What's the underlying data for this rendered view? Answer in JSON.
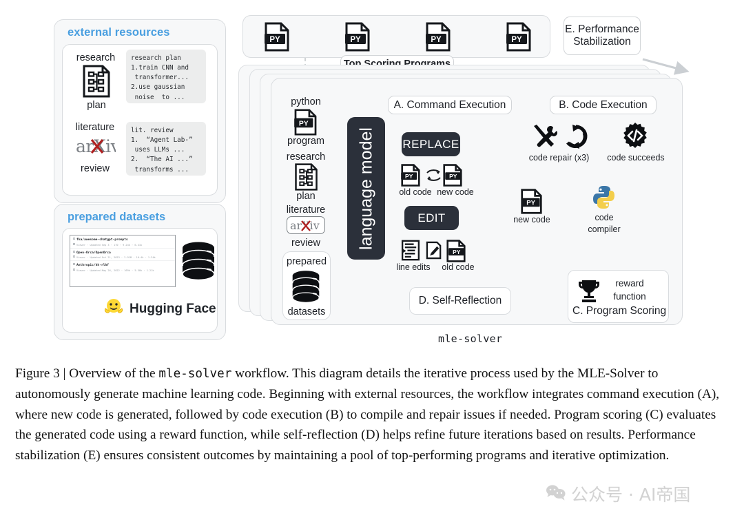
{
  "figure": {
    "label": "Figure 3 |",
    "caption_part1": " Overview of the ",
    "caption_mono": "mle-solver",
    "caption_part2": " workflow. This diagram details the iterative process used by the MLE-Solver to autonomously generate machine learning code. Beginning with external resources, the workflow integrates command execution (A), where new code is generated, followed by code execution (B) to compile and repair issues if needed. Program scoring (C) evaluates the generated code using a reward function, while self-reflection (D) helps refine future iterations based on results. Performance stabilization (E) ensures consistent outcomes by maintaining a pool of top-performing programs and iterative optimization.",
    "solver_name": "mle-solver"
  },
  "colors": {
    "accent_blue": "#4a9fe0",
    "dark": "#2b303a",
    "panel_bg": "#f7f8f9",
    "red_dash": "#e9a3a3",
    "green_dash": "#a8d9ae",
    "gray_dash": "#c8cccf"
  },
  "external_resources": {
    "title": "external resources",
    "items": [
      {
        "label_top": "research",
        "label_bottom": "plan",
        "icon": "document-flowchart-icon",
        "text_lines": "research plan\n1.train CNN and\n transformer...\n2.use gaussian\n noise  to ..."
      },
      {
        "label_top": "literature",
        "label_bottom": "review",
        "icon": "arxiv-logo-icon",
        "arxiv_text": "arXiv",
        "text_lines": "lit. review\n1.  “Agent Lab-”\n uses LLMs ...\n2.  “The AI ...”\n transforms ..."
      }
    ]
  },
  "prepared_datasets": {
    "title": "prepared datasets",
    "brand": "Hugging Face",
    "brand_icon": "hugging-face-emoji-icon",
    "db_icon": "database-stack-icon",
    "rows": [
      {
        "name": "fka/awesome-chatgpt-prompts",
        "meta": "Viewer · Updated Sep 3 · 170 · 9.24k · 6.41k"
      },
      {
        "name": "Open-Orca/OpenOrca",
        "meta": "Viewer · Updated Oct 21, 2023 · 2.91M · 10.4k · 1.34k"
      },
      {
        "name": "Anthropic/hh-rlhf",
        "meta": "Viewer · Updated May 26, 2022 · 169k · 5.50k · 1.21k"
      }
    ]
  },
  "top_bar": {
    "title": "Top Scoring Programs",
    "program_icon": "py-file-icon",
    "program_count": 4,
    "performance_stabilization": "E. Performance\nStabilization"
  },
  "solver": {
    "inputs": [
      {
        "label_top": "python",
        "label_bottom": "program",
        "icon": "py-file-icon"
      },
      {
        "label_top": "research",
        "label_bottom": "plan",
        "icon": "document-flowchart-icon"
      },
      {
        "label_top": "literature",
        "label_bottom": "review",
        "icon": "arxiv-logo-icon",
        "arxiv_text": "arXiv"
      },
      {
        "label_top": "prepared",
        "label_bottom": "datasets",
        "icon": "database-stack-icon"
      }
    ],
    "language_model": "language model",
    "command_execution": {
      "title": "A. Command Execution",
      "commands": [
        {
          "name": "REPLACE",
          "icons": [
            {
              "icon": "py-file-icon",
              "label": "old code"
            },
            {
              "icon": "swap-arrows-icon",
              "label": ""
            },
            {
              "icon": "py-file-icon",
              "label": "new code"
            }
          ]
        },
        {
          "name": "EDIT",
          "icons": [
            {
              "icon": "line-edits-icon",
              "label": "line edits"
            },
            {
              "icon": "pencil-square-icon",
              "label": ""
            },
            {
              "icon": "py-file-icon",
              "label": "old code"
            }
          ]
        }
      ]
    },
    "new_code": {
      "label": "new code",
      "icon": "py-file-icon"
    },
    "code_execution": {
      "title": "B. Code Execution",
      "repair": {
        "label": "code repair (x3)",
        "icons": [
          "wrench-screwdriver-icon",
          "refresh-cycle-icon"
        ]
      },
      "succeeds": {
        "label": "code succeeds",
        "icon": "code-gear-icon"
      },
      "compiler": {
        "label": "code\ncompiler",
        "icon": "python-logo-icon"
      }
    },
    "self_reflection": {
      "title": "D.  Self-Reflection"
    },
    "program_scoring": {
      "title": "C. Program Scoring",
      "reward": "reward\nfunction",
      "icon": "trophy-icon"
    }
  },
  "watermark": {
    "icon": "wechat-icon",
    "text": "公众号 · AI帝国"
  }
}
